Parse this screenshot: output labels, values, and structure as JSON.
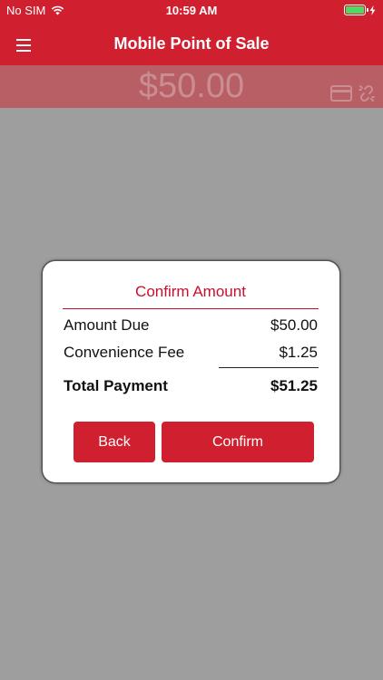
{
  "status": {
    "carrier": "No SIM",
    "time": "10:59 AM",
    "battery_color": "#4cd964"
  },
  "nav": {
    "title": "Mobile Point of Sale",
    "menu_icon": "hamburger-icon"
  },
  "amount": {
    "display": "$50.00",
    "icons": [
      "credit-card-icon",
      "unlink-icon"
    ]
  },
  "dialog": {
    "title": "Confirm Amount",
    "rows": [
      {
        "label": "Amount Due",
        "value": "$50.00"
      },
      {
        "label": "Convenience Fee",
        "value": "$1.25"
      }
    ],
    "total": {
      "label": "Total Payment",
      "value": "$51.25"
    },
    "buttons": {
      "back": "Back",
      "confirm": "Confirm"
    }
  },
  "colors": {
    "brand_red": "#d0202f",
    "title_red": "#c8102e",
    "overlay": "#9e9e9e"
  }
}
